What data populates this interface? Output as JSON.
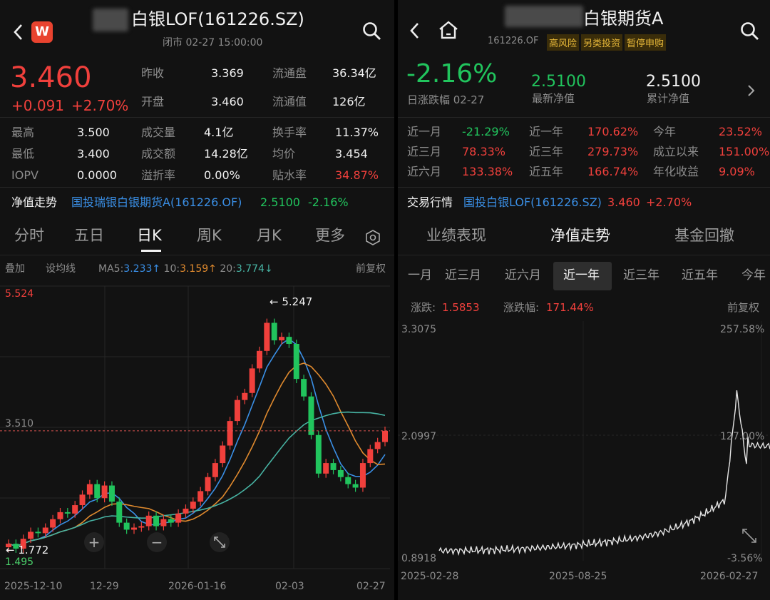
{
  "left": {
    "title": "白银LOF(161226.SZ)",
    "status": "闭市  02-27 15:00:00",
    "logo_letter": "W",
    "price": "3.460",
    "change": "+0.091",
    "change_pct": "+2.70%",
    "stats": [
      [
        "昨收",
        "3.369",
        "流通盘",
        "36.34亿"
      ],
      [
        "开盘",
        "3.460",
        "流通值",
        "126亿"
      ]
    ],
    "stats2": [
      [
        "最高",
        "3.500",
        "成交量",
        "4.1亿",
        "换手率",
        "11.37%"
      ],
      [
        "最低",
        "3.400",
        "成交额",
        "14.28亿",
        "均价",
        "3.454"
      ],
      [
        "IOPV",
        "0.0000",
        "溢折率",
        "0.00%",
        "贴水率",
        "34.87%"
      ]
    ],
    "nav_label": "净值走势",
    "nav_fund": "国投瑞银白银期货A(161226.OF)",
    "nav_value": "2.5100",
    "nav_change": "-2.16%",
    "tabs": [
      "分时",
      "五日",
      "日K",
      "周K",
      "月K",
      "更多"
    ],
    "active_tab": "日K",
    "tools": {
      "overlay": "叠加",
      "ma_setting": "设均线",
      "adjust": "前复权"
    },
    "ma": {
      "ma5_label": "MA5:",
      "ma5": "3.233↑",
      "ma10_label": "10:",
      "ma10": "3.159↑",
      "ma20_label": "20:",
      "ma20": "3.774↓"
    },
    "chart_labels": {
      "high": "5.524",
      "mid": "3.510",
      "low": "1.495",
      "max_mark": "← 5.247",
      "min_mark": "← 1.772"
    },
    "dates": [
      "2025-12-10",
      "12-29",
      "2026-01-16",
      "02-03",
      "02-27"
    ]
  },
  "right": {
    "title": "白银期货A",
    "code": "161226.OF",
    "tags": [
      "高风险",
      "另类投资",
      "暂停申购"
    ],
    "day_change": "-2.16%",
    "day_change_label": "日涨跌幅 02-27",
    "nav": "2.5100",
    "nav_label": "最新净值",
    "acc_nav": "2.5100",
    "acc_nav_label": "累计净值",
    "returns": [
      [
        "近一月",
        "-21.29%",
        "近一年",
        "170.62%",
        "今年",
        "23.52%"
      ],
      [
        "近三月",
        "78.33%",
        "近三年",
        "279.73%",
        "成立以来",
        "151.00%"
      ],
      [
        "近六月",
        "133.38%",
        "近五年",
        "166.74%",
        "年化收益",
        "9.09%"
      ]
    ],
    "market_label": "交易行情",
    "market_fund": "国投白银LOF(161226.SZ)",
    "market_price": "3.460",
    "market_change": "+2.70%",
    "tabs": [
      "业绩表现",
      "净值走势",
      "基金回撤"
    ],
    "active_tab": "净值走势",
    "periods": [
      "一月",
      "近三月",
      "近六月",
      "近一年",
      "近三年",
      "近五年",
      "今年"
    ],
    "active_period": "近一年",
    "chg_label": "涨跌:",
    "chg": "1.5853",
    "chg_pct_label": "涨跌幅:",
    "chg_pct": "171.44%",
    "adjust": "前复权",
    "chart_labels": {
      "ymax": "3.3075",
      "ymid": "2.0997",
      "ymin": "0.8918",
      "pmax": "257.58%",
      "pmid": "127.00%",
      "pmin": "-3.56%"
    },
    "dates": [
      "2025-02-28",
      "2025-08-25",
      "2026-02-27"
    ]
  },
  "chart_data": [
    {
      "type": "candlestick",
      "title": "",
      "x_labels": [
        "2025-12-10",
        "12-29",
        "2026-01-16",
        "02-03",
        "02-27"
      ],
      "ylim": [
        1.495,
        5.524
      ],
      "max": 5.247,
      "min": 1.772,
      "last": 3.46,
      "closes": [
        1.85,
        1.78,
        1.92,
        2.02,
        2.0,
        2.08,
        2.2,
        2.3,
        2.28,
        2.4,
        2.55,
        2.7,
        2.5,
        2.68,
        2.45,
        2.15,
        2.05,
        2.08,
        2.1,
        2.25,
        2.1,
        2.2,
        2.15,
        2.28,
        2.35,
        2.45,
        2.6,
        2.8,
        3.0,
        3.25,
        3.6,
        3.9,
        4.0,
        4.35,
        4.6,
        5.0,
        4.75,
        4.8,
        4.7,
        4.2,
        3.95,
        3.4,
        2.85,
        3.0,
        2.9,
        2.8,
        2.7,
        2.65,
        3.0,
        3.2,
        3.3,
        3.46
      ]
    },
    {
      "type": "line",
      "title": "",
      "x_labels": [
        "2025-02-28",
        "2025-08-25",
        "2026-02-27"
      ],
      "ylim": [
        0.8918,
        3.3075
      ],
      "pct_range": [
        "-3.56%",
        "257.58%"
      ]
    }
  ],
  "colors": {
    "up": "#f0403c",
    "down": "#21c45d",
    "ma5": "#3a8fe6",
    "ma10": "#e08a2e",
    "ma20": "#47b3a3",
    "nav_line": "#e6e6e6"
  }
}
